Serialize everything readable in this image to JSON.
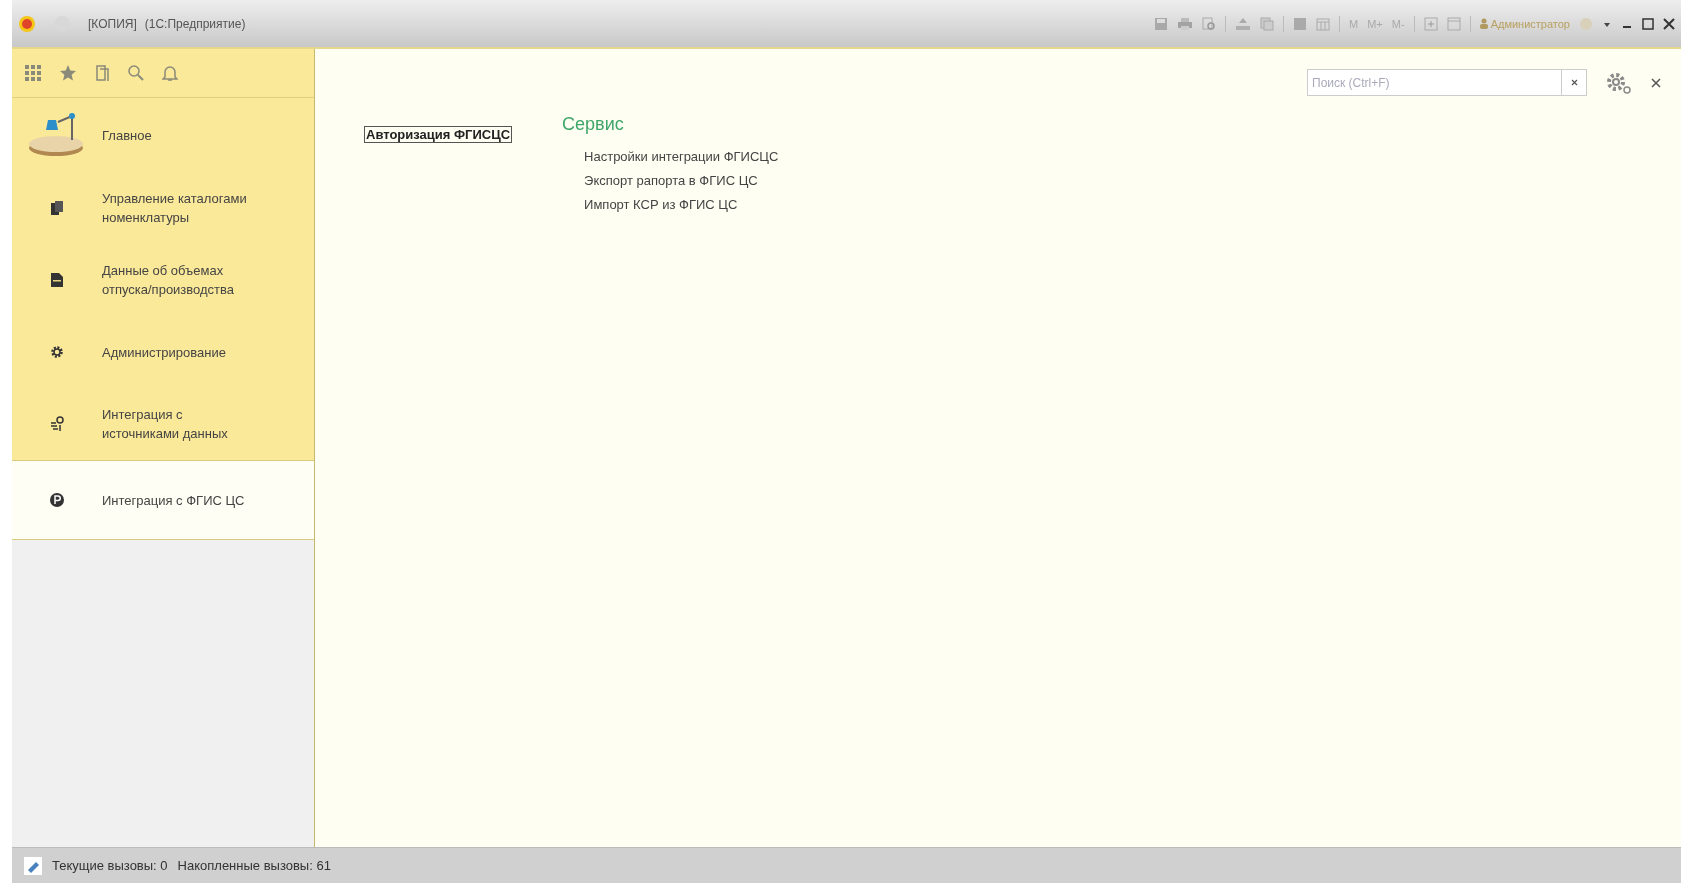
{
  "window": {
    "title": "[КОПИЯ]",
    "app_name": "(1С:Предприятие)"
  },
  "toolbar": {
    "memory_buttons": [
      "M",
      "M+",
      "M-"
    ],
    "user": "Администратор"
  },
  "sidebar": {
    "items": [
      {
        "label": "Главное",
        "kind": "home",
        "selected": false
      },
      {
        "label": "Управление каталогами номенклатуры",
        "kind": "catalog",
        "selected": false
      },
      {
        "label": "Данные об объемах отпуска/производства",
        "kind": "document",
        "selected": false
      },
      {
        "label": "Администрирование",
        "kind": "gear",
        "selected": false
      },
      {
        "label": "Интеграция с источниками данных",
        "kind": "integration",
        "selected": false
      },
      {
        "label": "Интеграция с ФГИС ЦС",
        "kind": "fgis",
        "selected": true
      }
    ]
  },
  "content": {
    "search": {
      "placeholder": "Поиск (Ctrl+F)"
    },
    "auth_command": "Авторизация ФГИСЦС",
    "section_title": "Сервис",
    "links": [
      "Настройки интеграции ФГИСЦС",
      "Экспорт рапорта  в ФГИС ЦС",
      "Импорт КСР из ФГИС ЦС"
    ]
  },
  "status_bar": {
    "current_calls": "Текущие вызовы: 0",
    "accumulated_calls": "Накопленные вызовы: 61"
  }
}
